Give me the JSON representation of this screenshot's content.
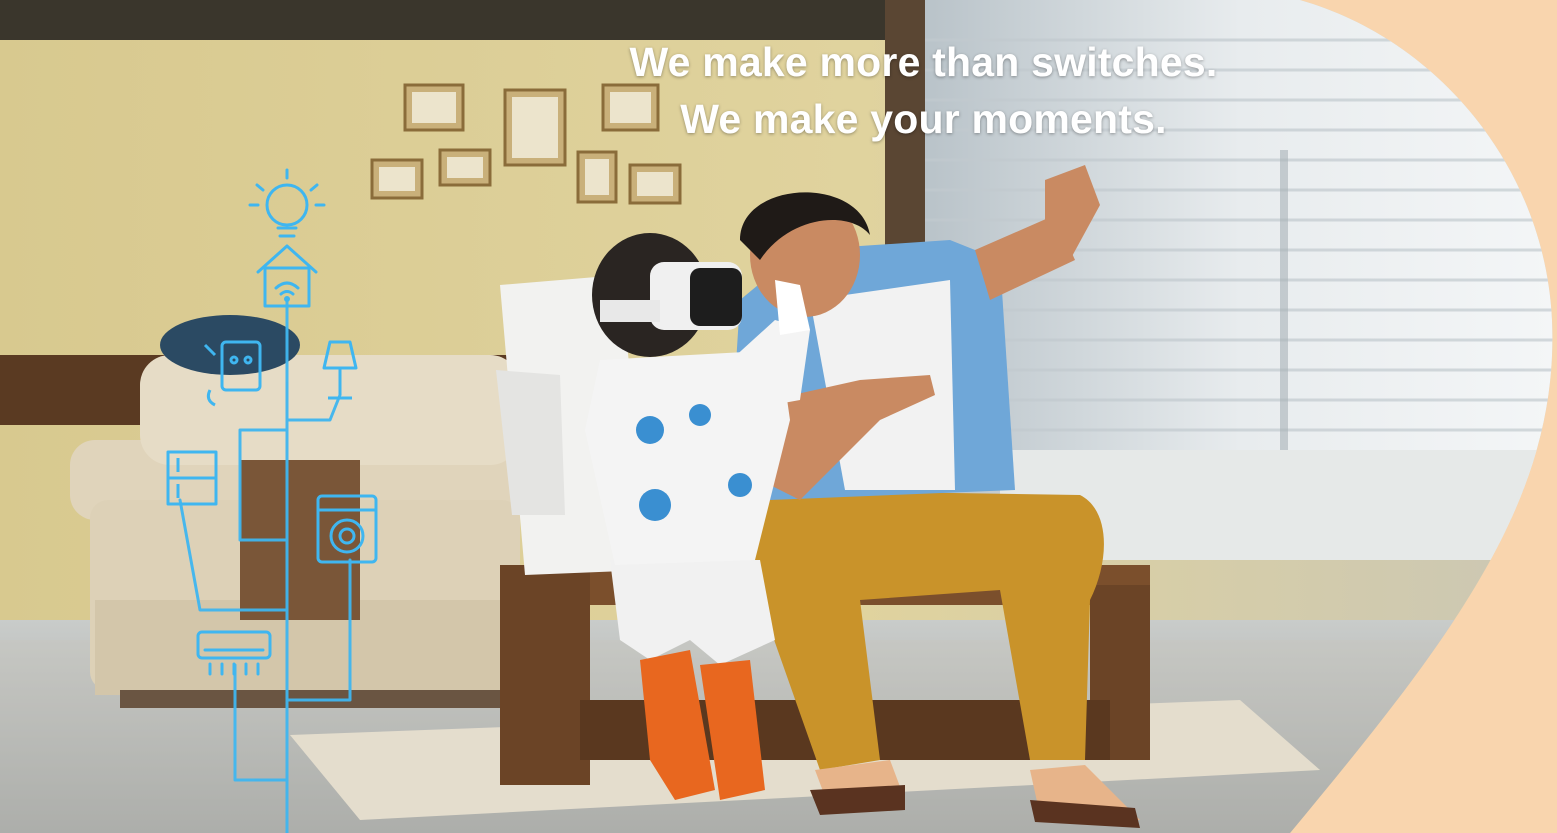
{
  "tagline": {
    "line1": "We make more than switches.",
    "line2": "We make your moments."
  },
  "colors": {
    "background_peach": "#f9d5ae",
    "tagline_text": "#ffffff",
    "icon_line": "#3fb6f0",
    "wall": "#d9cc96",
    "sofa": "#e3d6bd",
    "bench_wood": "#6b4426",
    "trousers": "#c9932a",
    "shirt": "#6fa7d8",
    "boots": "#e8671f"
  },
  "icons": [
    "lightbulb-icon",
    "smart-home-wifi-icon",
    "wall-socket-icon",
    "table-lamp-icon",
    "refrigerator-icon",
    "washing-machine-icon",
    "air-conditioner-icon"
  ]
}
